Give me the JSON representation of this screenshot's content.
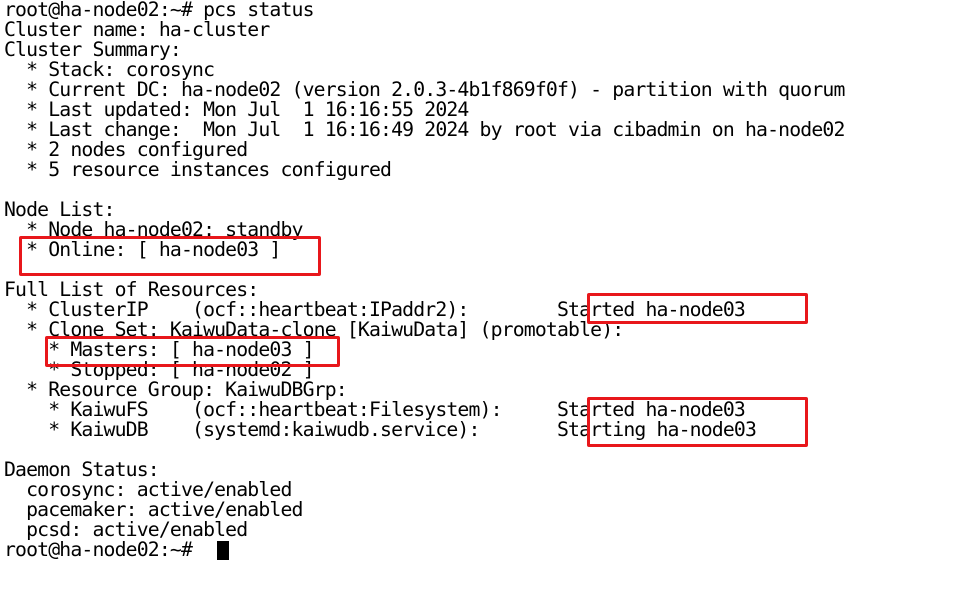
{
  "terminal": {
    "lines": [
      "root@ha-node02:~# pcs status",
      "Cluster name: ha-cluster",
      "Cluster Summary:",
      "  * Stack: corosync",
      "  * Current DC: ha-node02 (version 2.0.3-4b1f869f0f) - partition with quorum",
      "  * Last updated: Mon Jul  1 16:16:55 2024",
      "  * Last change:  Mon Jul  1 16:16:49 2024 by root via cibadmin on ha-node02",
      "  * 2 nodes configured",
      "  * 5 resource instances configured",
      "",
      "Node List:",
      "  * Node ha-node02: standby",
      "  * Online: [ ha-node03 ]",
      "",
      "Full List of Resources:",
      "  * ClusterIP    (ocf::heartbeat:IPaddr2):        Started ha-node03",
      "  * Clone Set: KaiwuData-clone [KaiwuData] (promotable):",
      "    * Masters: [ ha-node03 ]",
      "    * Stopped: [ ha-node02 ]",
      "  * Resource Group: KaiwuDBGrp:",
      "    * KaiwuFS    (ocf::heartbeat:Filesystem):     Started ha-node03",
      "    * KaiwuDB    (systemd:kaiwudb.service):       Starting ha-node03",
      "",
      "Daemon Status:",
      "  corosync: active/enabled",
      "  pacemaker: active/enabled",
      "  pcsd: active/enabled",
      "root@ha-node02:~# "
    ]
  },
  "highlight_color": "#e8171b",
  "text_color": "#000000",
  "background_color": "#ffffff"
}
